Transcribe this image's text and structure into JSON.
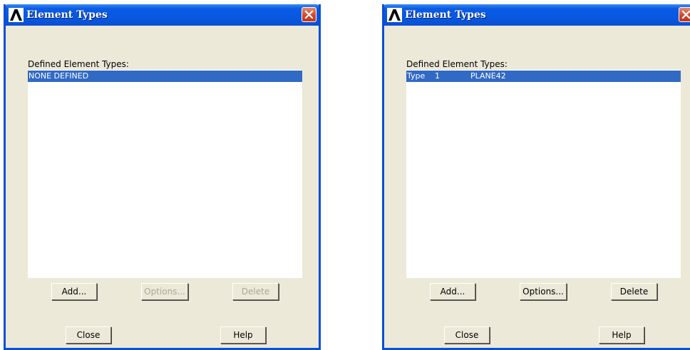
{
  "dialogs": [
    {
      "title": "Element Types",
      "label": "Defined Element Types:",
      "row_text": "NONE DEFINED",
      "buttons": {
        "add": "Add...",
        "options": "Options...",
        "delete": "Delete",
        "close": "Close",
        "help": "Help"
      },
      "options_enabled": false,
      "delete_enabled": false
    },
    {
      "title": "Element Types",
      "label": "Defined Element Types:",
      "row_type": "Type",
      "row_number": "1",
      "row_element": "PLANE42",
      "buttons": {
        "add": "Add...",
        "options": "Options...",
        "delete": "Delete",
        "close": "Close",
        "help": "Help"
      },
      "options_enabled": true,
      "delete_enabled": true
    }
  ],
  "colors": {
    "titlebar": "#0a5ce4",
    "selection": "#316ac5",
    "dialog_bg": "#ece9d8"
  }
}
